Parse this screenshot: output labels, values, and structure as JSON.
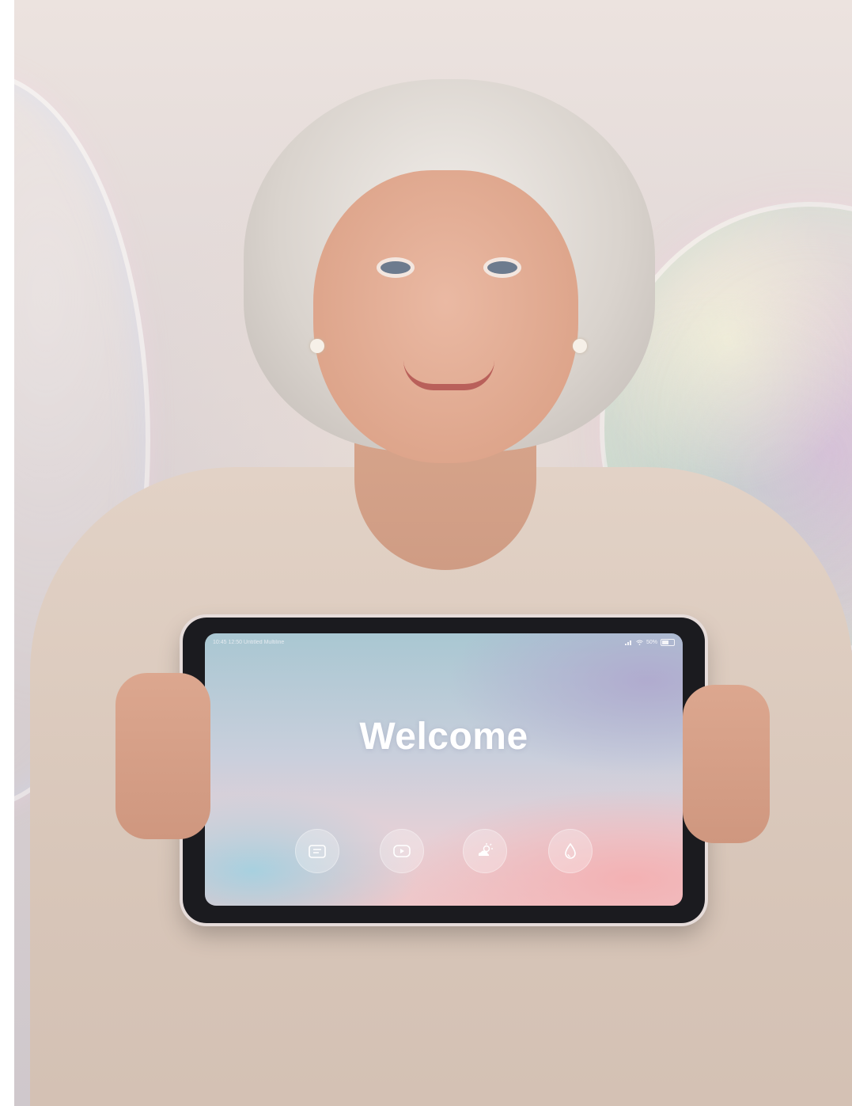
{
  "tablet": {
    "status_bar": {
      "left_text": "10:45 12:50  Untitled  Multiline",
      "battery": "50%",
      "battery_level": 0.5
    },
    "welcome_title": "Welcome",
    "icons": [
      "menu-card-icon",
      "play-icon",
      "weather-sun-cloud-icon",
      "drop-icon"
    ]
  }
}
